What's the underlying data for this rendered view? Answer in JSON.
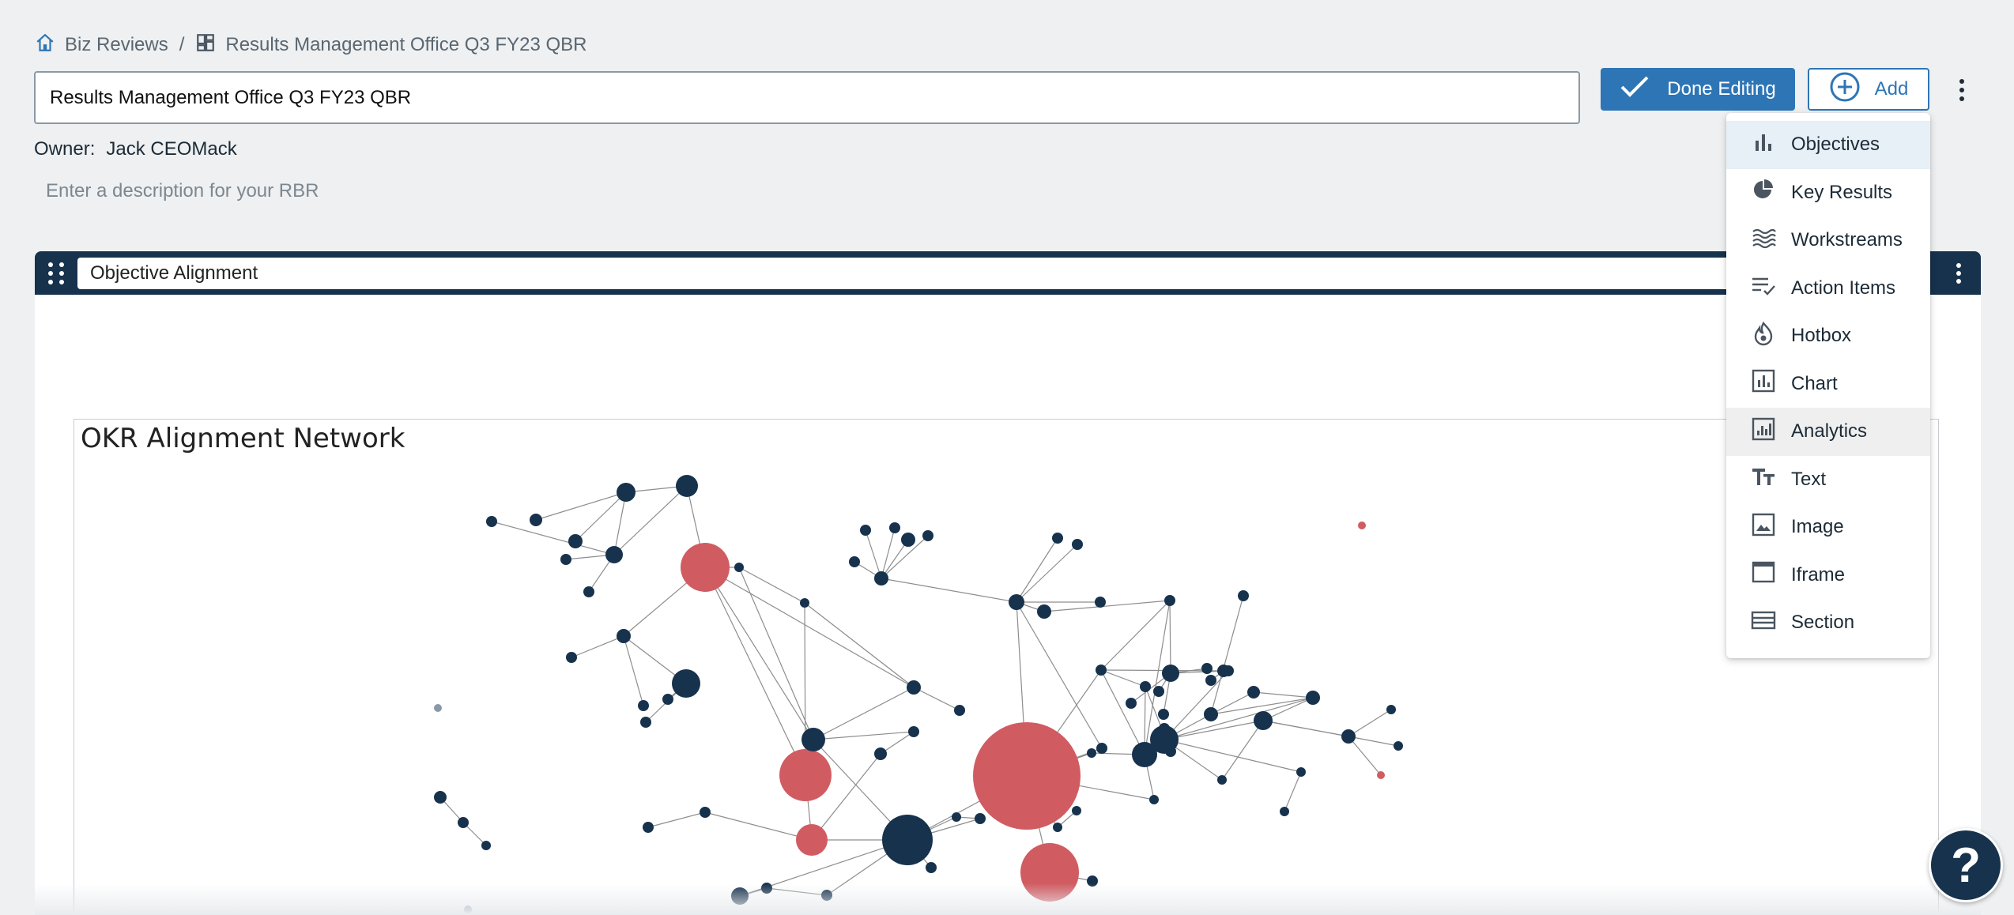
{
  "breadcrumb": {
    "root_label": "Biz Reviews",
    "separator": "/",
    "current_label": "Results Management Office Q3 FY23 QBR"
  },
  "header": {
    "title_value": "Results Management Office Q3 FY23 QBR",
    "done_label": "Done Editing",
    "add_label": "Add"
  },
  "owner": {
    "label": "Owner:",
    "name": "Jack CEOMack"
  },
  "description": {
    "placeholder": "Enter a description for your RBR"
  },
  "section": {
    "title_value": "Objective Alignment",
    "chart_title": "OKR Alignment Network"
  },
  "add_menu": {
    "items": [
      {
        "label": "Objectives",
        "icon": "bar-chart-icon"
      },
      {
        "label": "Key Results",
        "icon": "pie-chart-icon"
      },
      {
        "label": "Workstreams",
        "icon": "waves-icon"
      },
      {
        "label": "Action Items",
        "icon": "checklist-icon"
      },
      {
        "label": "Hotbox",
        "icon": "flame-icon"
      },
      {
        "label": "Chart",
        "icon": "chart-box-icon"
      },
      {
        "label": "Analytics",
        "icon": "analytics-icon"
      },
      {
        "label": "Text",
        "icon": "text-icon"
      },
      {
        "label": "Image",
        "icon": "image-icon"
      },
      {
        "label": "Iframe",
        "icon": "iframe-icon"
      },
      {
        "label": "Section",
        "icon": "section-icon"
      }
    ]
  },
  "help": {
    "label": "?"
  },
  "colors": {
    "navy": "#17324d",
    "accent": "#2e75b6",
    "node_red": "#d05c62",
    "node_dark": "#17324d",
    "node_grey": "#8a99a8"
  }
}
